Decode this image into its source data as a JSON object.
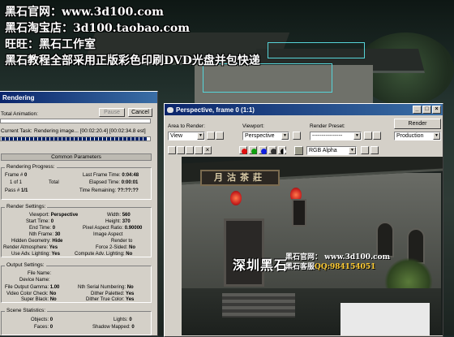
{
  "overlay": {
    "line1_label": "黑石官网：",
    "line1_url": "www.3d100.com",
    "line2_label": "黑石淘宝店：",
    "line2_url": "3d100.taobao.com",
    "line3": "旺旺：黑石工作室",
    "line4": "黑石教程全部采用正版彩色印刷DVD光盘并包快递"
  },
  "rendering": {
    "title": "Rendering",
    "total_animation_label": "Total Animation:",
    "pause_label": "Pause",
    "cancel_label": "Cancel",
    "current_task_label": "Current Task:",
    "current_task_value": "Rendering image... [00:02:20.4] [00:02:34.8 est]",
    "common_params_title": "Common Parameters",
    "progress_group": "Rendering Progress:",
    "frame_label": "Frame #",
    "frame_value": "0",
    "of_label": "1 of 1",
    "total_label": "Total",
    "pass_label": "Pass #",
    "pass_value": "1/1",
    "last_frame_time_label": "Last Frame Time:",
    "last_frame_time_value": "0:04:48",
    "elapsed_time_label": "Elapsed Time:",
    "elapsed_time_value": "0:00:01",
    "time_remaining_label": "Time Remaining:",
    "time_remaining_value": "??:??:??",
    "render_settings_group": "Render Settings:",
    "viewport_label": "Viewport:",
    "viewport_value": "Perspective",
    "width_label": "Width:",
    "width_value": "560",
    "start_time_label": "Start Time:",
    "start_time_value": "0",
    "height_label": "Height:",
    "height_value": "370",
    "end_time_label": "End Time:",
    "end_time_value": "0",
    "pixel_aspect_label": "Pixel Aspect Ratio:",
    "pixel_aspect_value": "0.90000",
    "nth_frame_label": "Nth Frame:",
    "nth_frame_value": "30",
    "image_aspect_label": "Image Aspect",
    "hidden_geometry_label": "Hidden Geometry:",
    "hidden_geometry_value": "Hide",
    "render_to_label": "Render to",
    "render_atmosphere_label": "Render Atmosphere:",
    "render_atmosphere_value": "Yes",
    "force_2sided_label": "Force 2-Sided:",
    "force_2sided_value": "No",
    "use_adv_lighting_label": "Use Adv. Lighting:",
    "use_adv_lighting_value": "Yes",
    "compute_adv_lighting_label": "Compute Adv. Lighting:",
    "compute_adv_lighting_value": "No",
    "output_settings_group": "Output Settings:",
    "file_name_label": "File Name:",
    "device_name_label": "Device Name:",
    "file_output_gamma_label": "File Output Gamma:",
    "file_output_gamma_value": "1.00",
    "nth_serial_label": "Nth Serial Numbering:",
    "nth_serial_value": "No",
    "video_color_check_label": "Video Color Check:",
    "video_color_check_value": "No",
    "dither_paletted_label": "Dither Paletted:",
    "dither_paletted_value": "Yes",
    "super_black_label": "Super Black:",
    "super_black_value": "No",
    "dither_true_color_label": "Dither True Color:",
    "dither_true_color_value": "Yes",
    "scene_stats_group": "Scene Statistics:",
    "objects_label": "Objects:",
    "objects_value": "0",
    "lights_label": "Lights:",
    "lights_value": "0",
    "faces_label": "Faces:",
    "faces_value": "0",
    "shadow_mapped_label": "Shadow Mapped:",
    "shadow_mapped_value": "0"
  },
  "perspective": {
    "title": "Perspective, frame 0 (1:1)",
    "area_to_render_label": "Area to Render:",
    "area_to_render_value": "View",
    "viewport_label": "Viewport:",
    "viewport_value": "Perspective",
    "render_preset_label": "Render Preset:",
    "render_preset_value": "----------------",
    "render_button": "Render",
    "production_value": "Production",
    "channel_value": "RGB Alpha",
    "sign_text": "月沽茶莊",
    "watermark_cn": "深圳黑石",
    "watermark_site_label": "黑石官网：",
    "watermark_site": "www.3d100.com",
    "watermark_qq_label": "黑石客服",
    "watermark_qq": "QQ:984154051",
    "channel_colors": {
      "red": "#e01010",
      "green": "#10a010",
      "blue": "#1020e0"
    }
  }
}
